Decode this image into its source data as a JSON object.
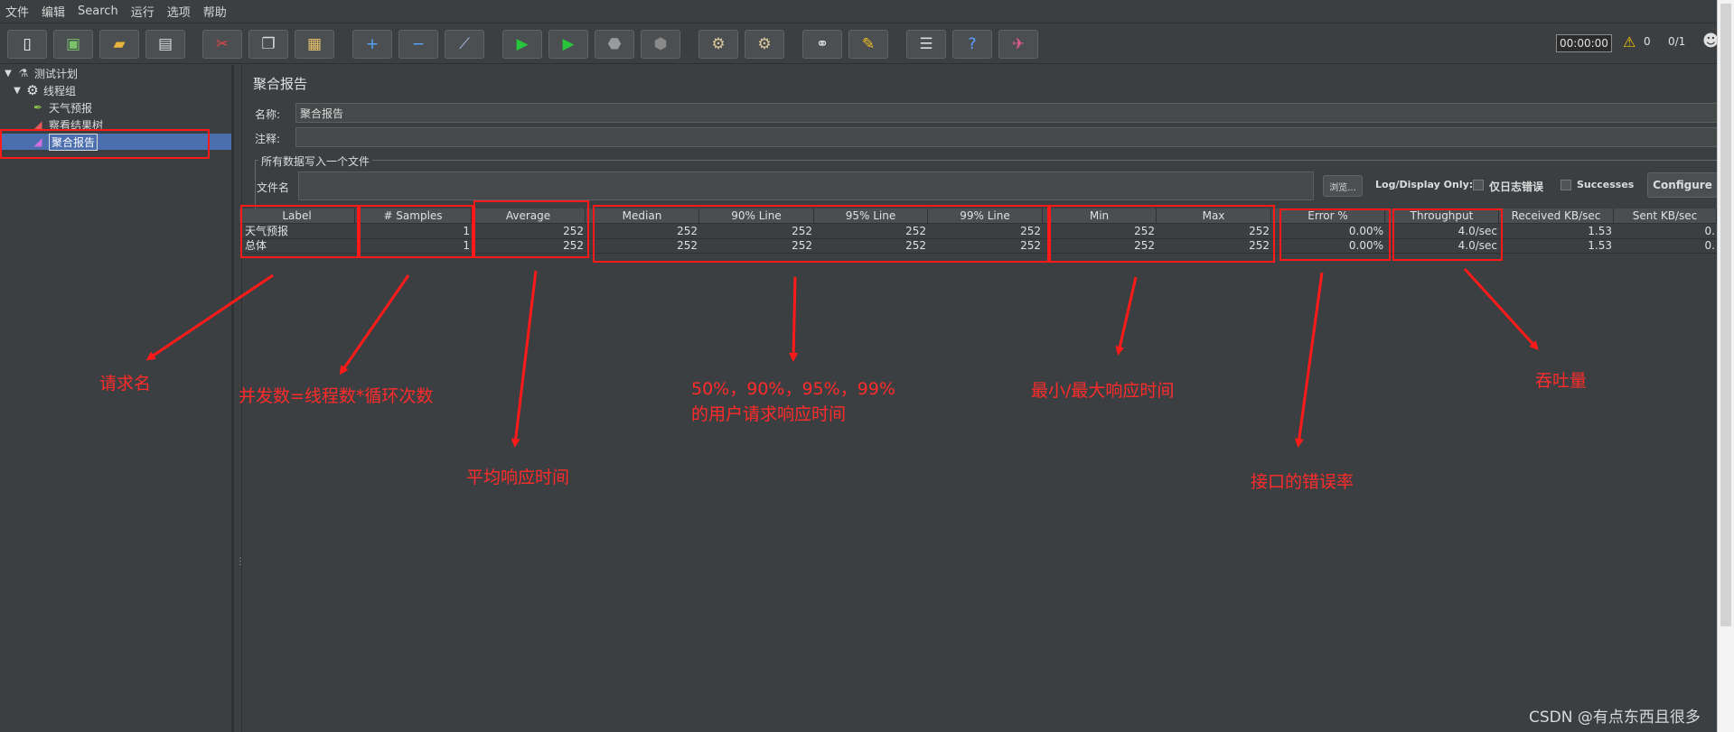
{
  "menubar": [
    "文件",
    "编辑",
    "Search",
    "运行",
    "选项",
    "帮助"
  ],
  "toolbar": {
    "icons": [
      "new-plan-icon",
      "templates-icon",
      "open-icon",
      "save-icon",
      "cut-icon",
      "copy-icon",
      "paste-icon",
      "expand-icon",
      "collapse-icon",
      "toggle-icon",
      "start-icon",
      "start-no-pause-icon",
      "stop-icon",
      "shutdown-icon",
      "clear-icon",
      "clear-all-icon",
      "search-icon",
      "reset-search-icon",
      "function-helper-icon",
      "help-icon",
      "remote-icon"
    ],
    "timer": "00:00:00",
    "warning_count": "0",
    "threads": "0/1"
  },
  "tree": {
    "items": [
      {
        "label": "测试计划",
        "icon": "flask-icon"
      },
      {
        "label": "线程组",
        "icon": "gear-icon"
      },
      {
        "label": "天气预报",
        "icon": "sampler-icon"
      },
      {
        "label": "察看结果树",
        "icon": "listener-icon"
      },
      {
        "label": "聚合报告",
        "icon": "report-icon"
      }
    ]
  },
  "panel": {
    "title": "聚合报告",
    "name_label": "名称:",
    "name_value": "聚合报告",
    "comment_label": "注释:",
    "comment_value": "",
    "file_group_title": "所有数据写入一个文件",
    "file_label": "文件名",
    "file_value": "",
    "browse_label": "浏览...",
    "log_display_label": "Log/Display Only:",
    "errors_only_label": "仅日志错误",
    "successes_label": "Successes",
    "configure_label": "Configure"
  },
  "table": {
    "headers": [
      "Label",
      "# Samples",
      "Average",
      "Median",
      "90% Line",
      "95% Line",
      "99% Line",
      "Min",
      "Max",
      "Error %",
      "Throughput",
      "Received KB/sec",
      "Sent KB/sec"
    ],
    "rows": [
      [
        "天气预报",
        "1",
        "252",
        "252",
        "252",
        "252",
        "252",
        "252",
        "252",
        "0.00%",
        "4.0/sec",
        "1.53",
        "0."
      ],
      [
        "总体",
        "1",
        "252",
        "252",
        "252",
        "252",
        "252",
        "252",
        "252",
        "0.00%",
        "4.0/sec",
        "1.53",
        "0."
      ]
    ]
  },
  "annotations": {
    "request_name": "请求名",
    "concurrency": "并发数=线程数*循环次数",
    "average": "平均响应时间",
    "percentiles_line1": "50%，90%，95%，99%",
    "percentiles_line2": "的用户请求响应时间",
    "minmax": "最小/最大响应时间",
    "error_rate": "接口的错误率",
    "throughput": "吞吐量",
    "color": "#ff1a1a"
  },
  "watermark": "CSDN @有点东西且很多"
}
